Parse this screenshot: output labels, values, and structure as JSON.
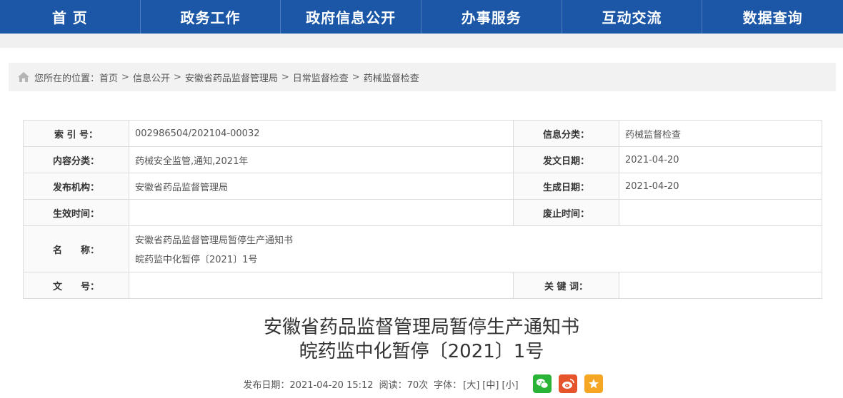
{
  "nav": [
    "首 页",
    "政务工作",
    "政府信息公开",
    "办事服务",
    "互动交流",
    "数据查询"
  ],
  "breadcrumb": {
    "prefix": "您所在的位置：",
    "items": [
      "首页",
      "信息公开",
      "安徽省药品监督管理局",
      "日常监督检查",
      "药械监督检查"
    ],
    "separator": ">"
  },
  "meta": {
    "index_label": "索 引 号：",
    "index_value": "002986504/202104-00032",
    "category_label": "信息分类：",
    "category_value": "药械监督检查",
    "content_label": "内容分类：",
    "content_value": "药械安全监管,通知,2021年",
    "issue_date_label": "发文日期：",
    "issue_date_value": "2021-04-20",
    "publisher_label": "发布机构：",
    "publisher_value": "安徽省药品监督管理局",
    "gen_date_label": "生成日期：",
    "gen_date_value": "2021-04-20",
    "effective_label": "生效时间：",
    "effective_value": "",
    "abolish_label": "废止时间：",
    "abolish_value": "",
    "name_label": "名　　称：",
    "name_line1": "安徽省药品监督管理局暂停生产通知书",
    "name_line2": "皖药监中化暂停〔2021〕1号",
    "docno_label": "文　　号：",
    "docno_value": "",
    "keywords_label": "关 键 词：",
    "keywords_value": ""
  },
  "article": {
    "title_line1": "安徽省药品监督管理局暂停生产通知书",
    "title_line2": "皖药监中化暂停〔2021〕1号"
  },
  "info": {
    "publish": "发布日期：2021-04-20 15:12",
    "reads": "阅读：70次",
    "font_label": "字体：",
    "font_large": "[大]",
    "font_medium": "[中]",
    "font_small": "[小]"
  },
  "colors": {
    "nav_bg": "#1b57a6",
    "wechat": "#2ab437",
    "weibo": "#e6542c",
    "star": "#f5a623"
  },
  "icons": [
    "home-icon",
    "wechat-icon",
    "weibo-icon",
    "star-icon"
  ]
}
